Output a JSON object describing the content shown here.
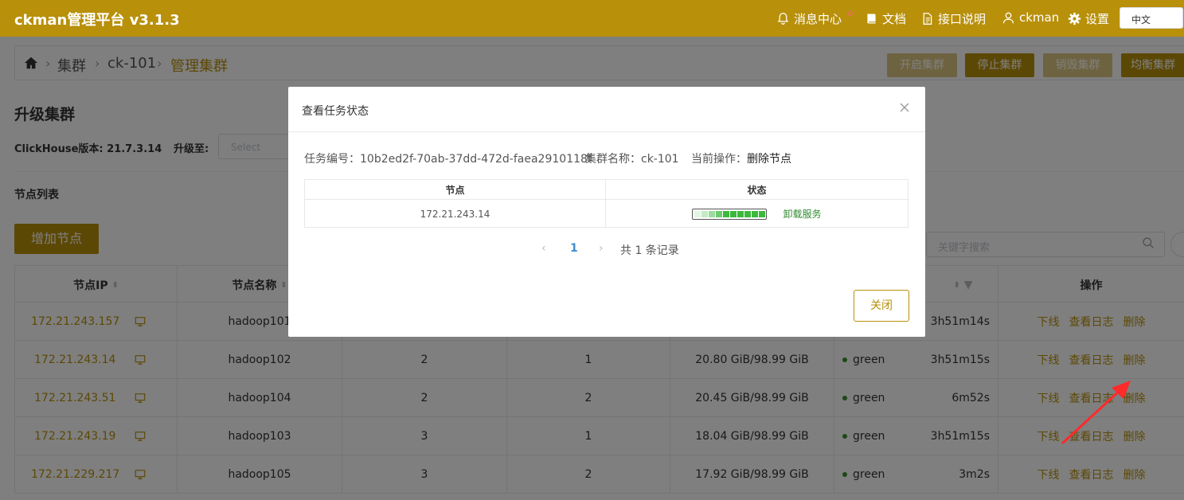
{
  "header": {
    "brand": "ckman管理平台 v3.1.3",
    "nav": {
      "messages": "消息中心",
      "docs": "文档",
      "api": "接口说明",
      "user": "ckman",
      "settings": "设置"
    },
    "language": "中文"
  },
  "breadcrumb": [
    "集群",
    "ck-101",
    "管理集群"
  ],
  "cluster_actions": {
    "start": "开启集群",
    "stop": "停止集群",
    "destroy": "销毁集群",
    "rebalance": "均衡集群"
  },
  "upgrade": {
    "title": "升级集群",
    "version_label": "ClickHouse版本: 21.7.3.14",
    "upgrade_to_label": "升级至:",
    "select_placeholder": "Select"
  },
  "nodes": {
    "title": "节点列表",
    "add_button": "增加节点",
    "search_placeholder": "关键字搜索",
    "columns": [
      "节点IP",
      "节点名称",
      "",
      "",
      "",
      "",
      "操作"
    ],
    "actions": [
      "下线",
      "查看日志",
      "删除"
    ],
    "rows": [
      {
        "ip": "172.21.243.157",
        "name": "hadoop101",
        "c3": "",
        "c4": "",
        "disk": "",
        "status": "",
        "uptime": "3h51m14s"
      },
      {
        "ip": "172.21.243.14",
        "name": "hadoop102",
        "c3": "2",
        "c4": "1",
        "disk": "20.80 GiB/98.99 GiB",
        "status": "green",
        "uptime": "3h51m15s"
      },
      {
        "ip": "172.21.243.51",
        "name": "hadoop104",
        "c3": "2",
        "c4": "2",
        "disk": "20.45 GiB/98.99 GiB",
        "status": "green",
        "uptime": "6m52s"
      },
      {
        "ip": "172.21.243.19",
        "name": "hadoop103",
        "c3": "3",
        "c4": "1",
        "disk": "18.04 GiB/98.99 GiB",
        "status": "green",
        "uptime": "3h51m15s"
      },
      {
        "ip": "172.21.229.217",
        "name": "hadoop105",
        "c3": "3",
        "c4": "2",
        "disk": "17.92 GiB/98.99 GiB",
        "status": "green",
        "uptime": "3m2s"
      }
    ]
  },
  "modal": {
    "title": "查看任务状态",
    "task_id": "任务编号：10b2ed2f-70ab-37dd-472d-faea2910118f",
    "cluster_name": "集群名称：ck-101",
    "current_op_label": "当前操作：",
    "current_op": "删除节点",
    "table_headers": [
      "节点",
      "状态"
    ],
    "row": {
      "node": "172.21.243.14",
      "status": "卸载服务",
      "progress": 0.9
    },
    "pager": {
      "prev": "‹",
      "page": "1",
      "next": "›",
      "total": "共 1 条记录"
    },
    "close_button": "关闭"
  },
  "colors": {
    "brand": "#b8900a",
    "success": "#3cb93c"
  }
}
